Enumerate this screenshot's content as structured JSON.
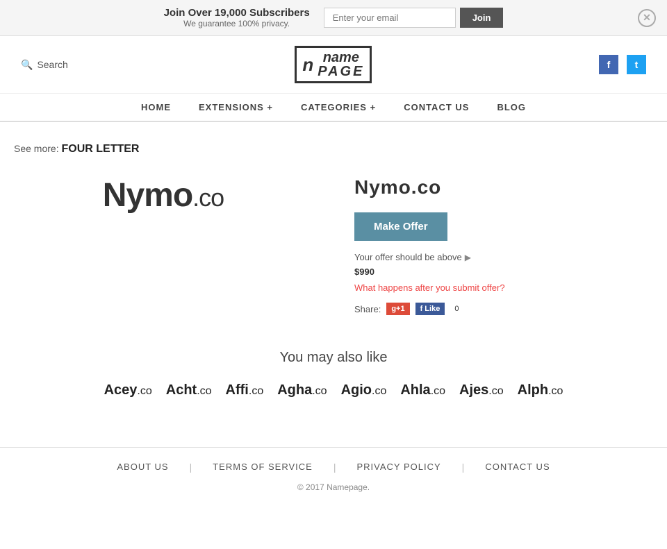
{
  "banner": {
    "main_text": "Join Over 19,000 Subscribers",
    "sub_text": "We guarantee 100% privacy.",
    "email_placeholder": "Enter your email",
    "join_button": "Join",
    "close_title": "close"
  },
  "header": {
    "search_label": "Search",
    "logo_icon": "n",
    "logo_name": "name",
    "logo_page": "PAGE",
    "facebook_label": "f",
    "twitter_label": "t"
  },
  "nav": {
    "items": [
      {
        "label": "HOME",
        "id": "home"
      },
      {
        "label": "EXTENSIONS +",
        "id": "extensions"
      },
      {
        "label": "CATEGORIES +",
        "id": "categories"
      },
      {
        "label": "CONTACT US",
        "id": "contact"
      },
      {
        "label": "BLOG",
        "id": "blog"
      }
    ]
  },
  "breadcrumb": {
    "see_more_prefix": "See more:",
    "category": "FOUR LETTER"
  },
  "domain": {
    "name": "Nymo",
    "tld": ".co",
    "full": "Nymo.co",
    "make_offer_label": "Make Offer",
    "offer_info": "Your offer should be above",
    "offer_min": "$990",
    "what_happens": "What happens after you submit offer?",
    "share_label": "Share:",
    "g_plus": "g+1",
    "fb_like": "f Like",
    "fb_count": "0"
  },
  "also_like": {
    "title": "You may also like",
    "items": [
      {
        "name": "Acey",
        "tld": ".co"
      },
      {
        "name": "Acht",
        "tld": ".co"
      },
      {
        "name": "Affi",
        "tld": ".co"
      },
      {
        "name": "Agha",
        "tld": ".co"
      },
      {
        "name": "Agio",
        "tld": ".co"
      },
      {
        "name": "Ahla",
        "tld": ".co"
      },
      {
        "name": "Ajes",
        "tld": ".co"
      },
      {
        "name": "Alph",
        "tld": ".co"
      }
    ]
  },
  "footer": {
    "links": [
      {
        "label": "ABOUT US",
        "id": "about"
      },
      {
        "label": "TERMS OF SERVICE",
        "id": "terms"
      },
      {
        "label": "PRIVACY POLICY",
        "id": "privacy"
      },
      {
        "label": "CONTACT US",
        "id": "contact"
      }
    ],
    "copyright": "© 2017",
    "site_name": "Namepage.",
    "dividers": [
      "|",
      "|",
      "|"
    ]
  }
}
